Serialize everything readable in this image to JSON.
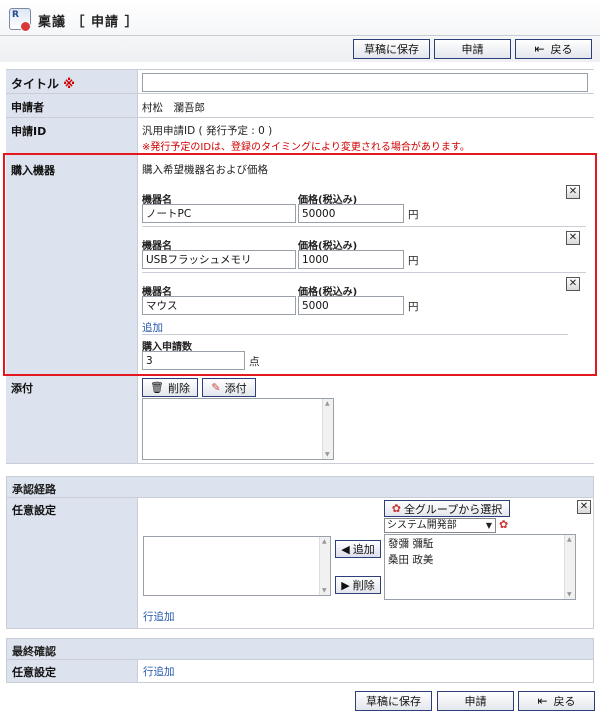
{
  "header": {
    "app_icon_text": "R",
    "title": "稟議 ［ 申請 ］",
    "buttons": {
      "draft": "草稿に保存",
      "apply": "申請",
      "back": "戻る"
    }
  },
  "form": {
    "title_label": "タイトル",
    "required_mark": "※",
    "title_value": "",
    "applicant_label": "申請者",
    "applicant_value": "村松　瀾吾郎",
    "id_label": "申請ID",
    "id_value": "汎用申請ID ( 発行予定 : 0 )",
    "id_note": "※発行予定のIDは、登録のタイミングにより変更される場合があります。",
    "purchase_label": "購入機器",
    "purchase_desc": "購入希望機器名および価格",
    "name_col": "機器名",
    "price_col": "価格(税込み)",
    "currency": "円",
    "items": [
      {
        "name": "ノートPC",
        "price": "50000"
      },
      {
        "name": "USBフラッシュメモリ",
        "price": "1000"
      },
      {
        "name": "マウス",
        "price": "5000"
      }
    ],
    "add_link": "追加",
    "count_label": "購入申請数",
    "count_value": "3",
    "count_unit": "点",
    "attach_label": "添付",
    "delete_btn": "削除",
    "attach_btn": "添付"
  },
  "approval": {
    "section": "承認経路",
    "optional_label": "任意設定",
    "select_all_groups": "全グループから選択",
    "group_select": "システム開発部",
    "add_btn": "追加",
    "remove_btn": "削除",
    "members": [
      "發彌 彌駈",
      "桑田 政美"
    ],
    "row_add": "行追加"
  },
  "final": {
    "section": "最終確認",
    "optional_label": "任意設定",
    "row_add": "行追加"
  },
  "footer": {
    "draft": "草稿に保存",
    "apply": "申請",
    "back": "戻る"
  }
}
